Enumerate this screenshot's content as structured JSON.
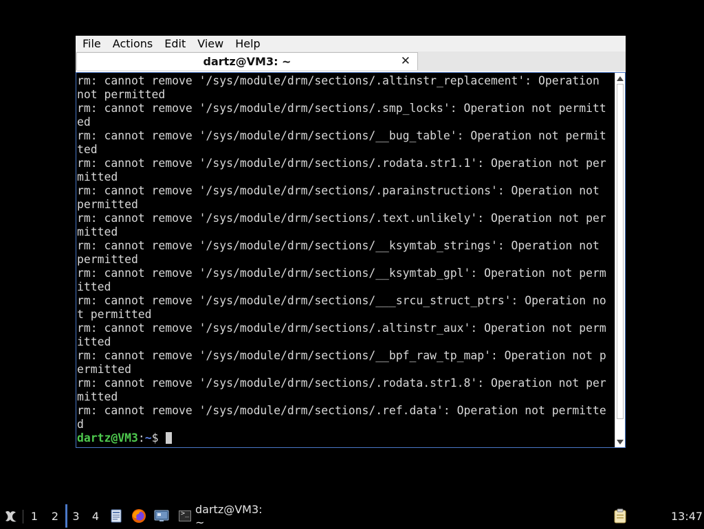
{
  "window": {
    "menus": [
      "File",
      "Actions",
      "Edit",
      "View",
      "Help"
    ],
    "tab_title": "dartz@VM3: ~",
    "tab_close": "✕"
  },
  "terminal": {
    "lines": [
      "rm: cannot remove '/sys/module/drm/sections/.altinstr_replacement': Operation",
      "not permitted",
      "rm: cannot remove '/sys/module/drm/sections/.smp_locks': Operation not permitt",
      "ed",
      "rm: cannot remove '/sys/module/drm/sections/__bug_table': Operation not permit",
      "ted",
      "rm: cannot remove '/sys/module/drm/sections/.rodata.str1.1': Operation not per",
      "mitted",
      "rm: cannot remove '/sys/module/drm/sections/.parainstructions': Operation not",
      "permitted",
      "rm: cannot remove '/sys/module/drm/sections/.text.unlikely': Operation not per",
      "mitted",
      "rm: cannot remove '/sys/module/drm/sections/__ksymtab_strings': Operation not",
      "permitted",
      "rm: cannot remove '/sys/module/drm/sections/__ksymtab_gpl': Operation not perm",
      "itted",
      "rm: cannot remove '/sys/module/drm/sections/___srcu_struct_ptrs': Operation no",
      "t permitted",
      "rm: cannot remove '/sys/module/drm/sections/.altinstr_aux': Operation not perm",
      "itted",
      "rm: cannot remove '/sys/module/drm/sections/__bpf_raw_tp_map': Operation not p",
      "ermitted",
      "rm: cannot remove '/sys/module/drm/sections/.rodata.str1.8': Operation not per",
      "mitted",
      "rm: cannot remove '/sys/module/drm/sections/.ref.data': Operation not permitte",
      "d"
    ],
    "prompt_user": "dartz@VM3",
    "prompt_sep": ":",
    "prompt_path": "~",
    "prompt_symbol": "$ "
  },
  "taskbar": {
    "start_icon": "start-menu-icon",
    "workspaces": [
      "1",
      "2",
      "3",
      "4"
    ],
    "active_workspace": "3",
    "launchers": [
      "file-manager-icon",
      "firefox-icon",
      "network-settings-icon"
    ],
    "task_label": "dartz@VM3: ~",
    "task_icon": "terminal-icon",
    "tray_icon": "clipboard-icon",
    "clock": "13:47"
  },
  "colors": {
    "terminal_bg": "#000000",
    "terminal_fg": "#d8d8d8",
    "prompt_user": "#4ec94e",
    "prompt_path": "#5a7ee0",
    "accent": "#4a78c8"
  }
}
